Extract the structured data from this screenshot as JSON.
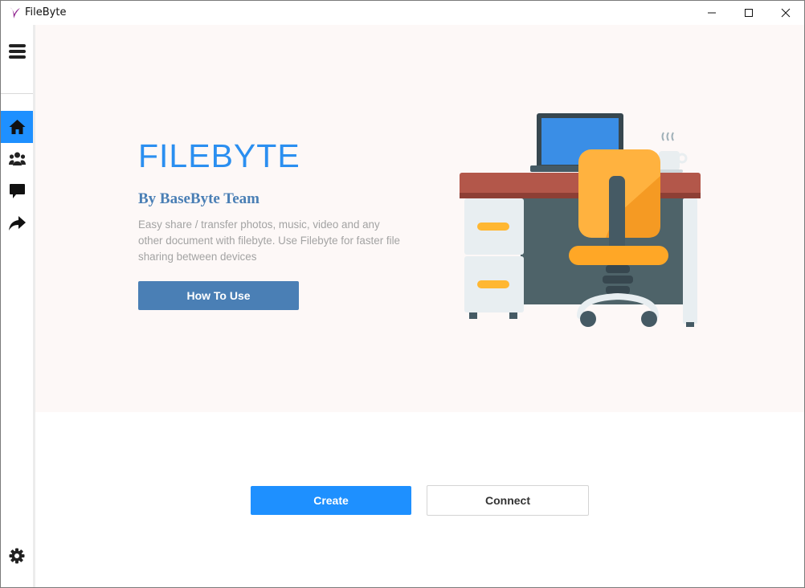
{
  "window": {
    "title": "FileByte",
    "controls": {
      "minimize": "minimize-icon",
      "maximize": "maximize-icon",
      "close": "close-icon"
    }
  },
  "sidebar": {
    "menu_icon": "hamburger-menu-icon",
    "items": [
      {
        "name": "home",
        "icon": "home-icon",
        "active": true
      },
      {
        "name": "users",
        "icon": "users-icon",
        "active": false
      },
      {
        "name": "messages",
        "icon": "chat-icon",
        "active": false
      },
      {
        "name": "share",
        "icon": "share-arrow-icon",
        "active": false
      }
    ],
    "settings_icon": "gear-icon"
  },
  "hero": {
    "title": "FILEBYTE",
    "subtitle": "By BaseByte Team",
    "description": "Easy share / transfer photos, music, video and any other document with filebyte. Use Filebyte for faster file sharing between devices",
    "button_label": "How To Use"
  },
  "actions": {
    "create_label": "Create",
    "connect_label": "Connect"
  },
  "colors": {
    "accent": "#1e90ff",
    "secondary": "#4a7fb5",
    "title": "#2b8ff0",
    "hero_bg": "#fdf8f7"
  }
}
